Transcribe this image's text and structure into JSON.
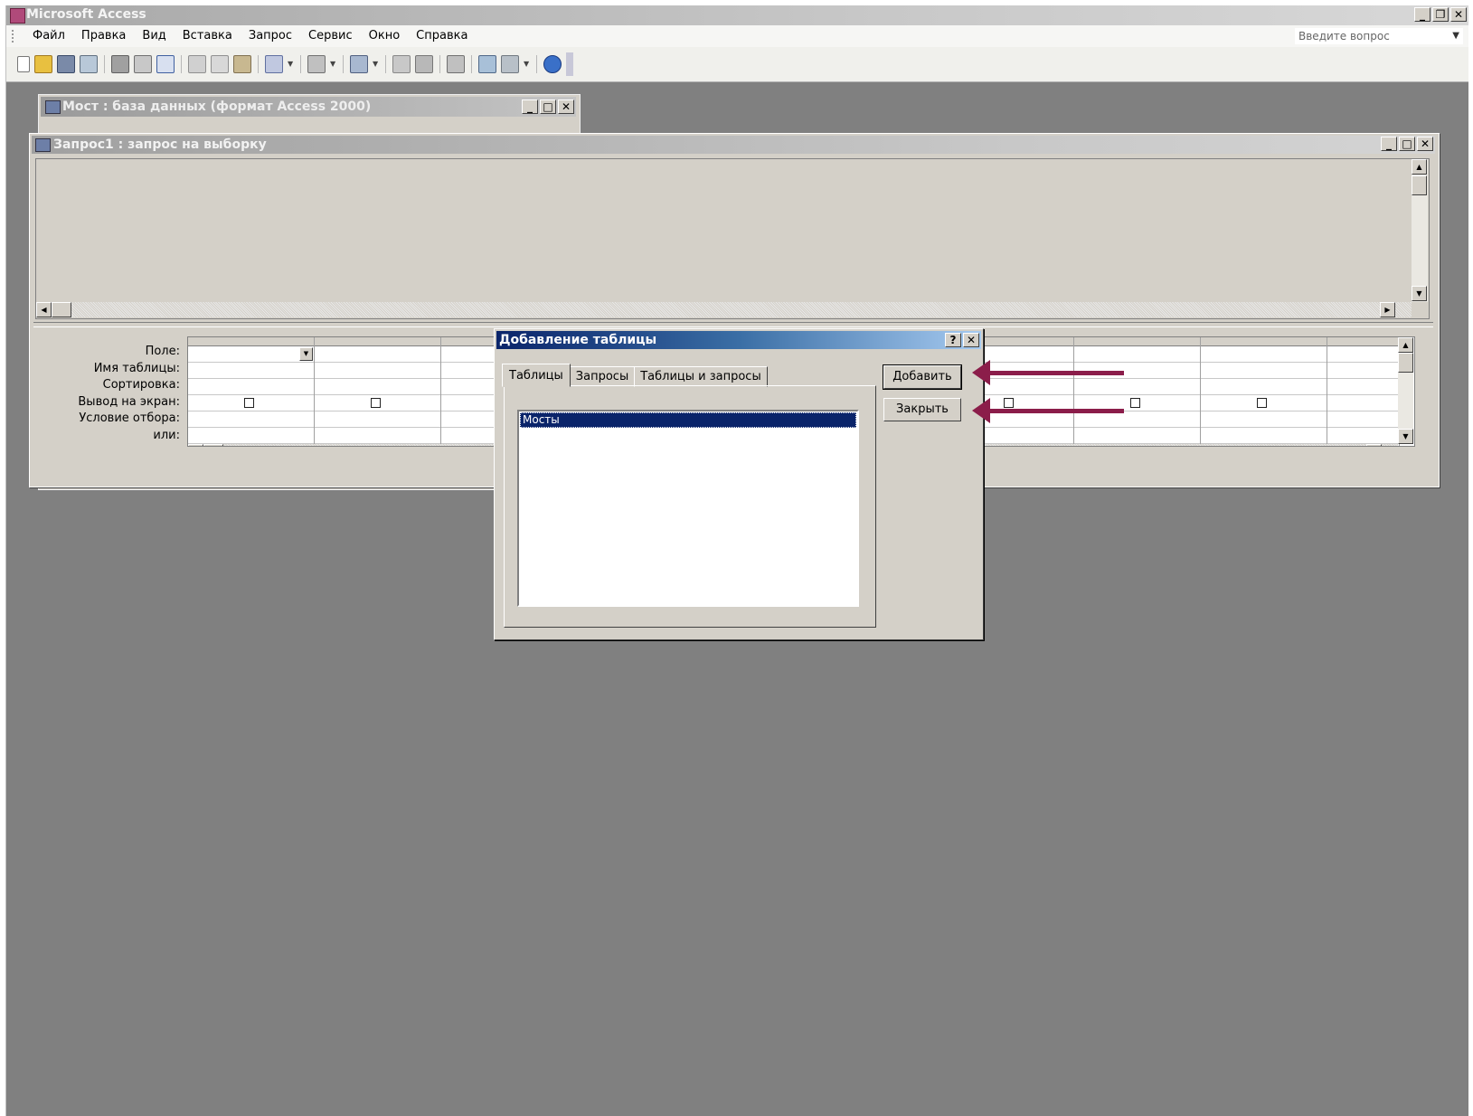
{
  "app": {
    "title": "Microsoft Access",
    "menu": [
      "Файл",
      "Правка",
      "Вид",
      "Вставка",
      "Запрос",
      "Сервис",
      "Окно",
      "Справка"
    ],
    "ask_placeholder": "Введите вопрос",
    "sys_buttons": {
      "minimize": "_",
      "restore": "❐",
      "close": "✕"
    }
  },
  "toolbar": {
    "icons": [
      "new-icon",
      "open-icon",
      "save-icon",
      "search-icon",
      "print-icon",
      "print-preview-icon",
      "spelling-icon",
      "cut-icon",
      "copy-icon",
      "paste-icon",
      "undo-icon",
      "query-type-icon",
      "query-icon",
      "show-table-icon",
      "relationships-icon",
      "properties-icon",
      "build-icon",
      "new-object-icon",
      "help-icon"
    ]
  },
  "db_window": {
    "title": "Мост : база данных (формат Access 2000)"
  },
  "query_window": {
    "title": "Запрос1 : запрос на выборку",
    "grid_labels": [
      "Поле:",
      "Имя таблицы:",
      "Сортировка:",
      "Вывод на экран:",
      "Условие отбора:",
      "или:"
    ]
  },
  "dialog": {
    "title": "Добавление таблицы",
    "help_btn": "?",
    "close_btn": "✕",
    "tabs": [
      "Таблицы",
      "Запросы",
      "Таблицы и запросы"
    ],
    "active_tab": "Таблицы",
    "list_items": [
      "Мосты"
    ],
    "selected_item": "Мосты",
    "add_button": "Добавить",
    "close_button": "Закрыть"
  },
  "colors": {
    "annotation_arrow": "#8b1d4a",
    "dialog_titlebar": "#0a246a",
    "workspace": "#808080"
  }
}
